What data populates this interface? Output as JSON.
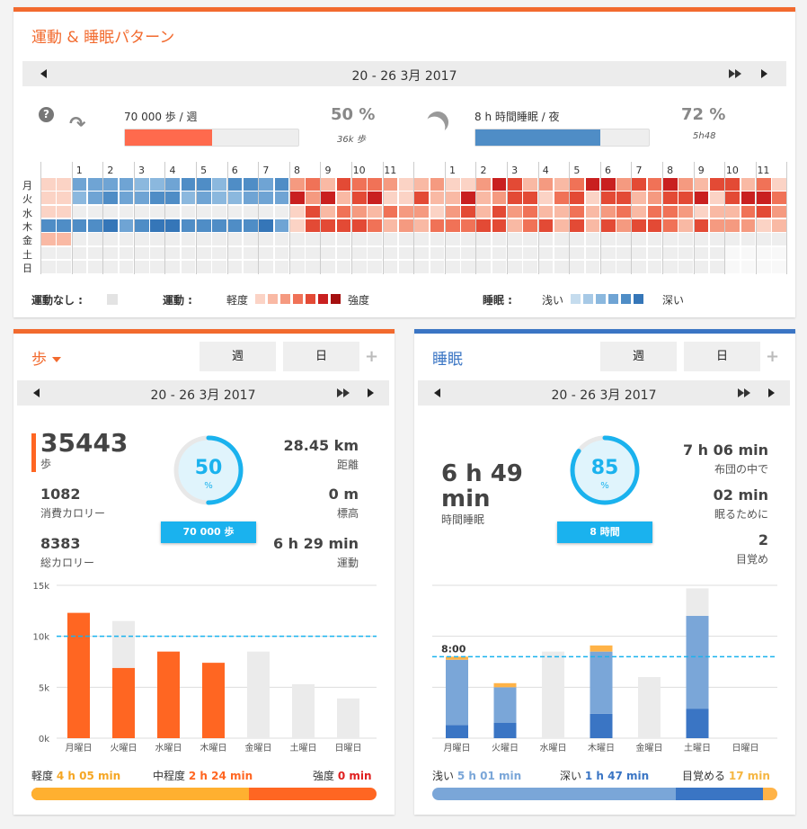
{
  "colors": {
    "orange": "#ff6622",
    "blue": "#3a75c4",
    "lightblue": "#7aa6d8",
    "amber": "#ffb347",
    "gray": "#ebebeb",
    "cyan": "#1ab2ee"
  },
  "header": {
    "title": "運動 & 睡眠パターン",
    "date_range": "20 - 26 3月 2017"
  },
  "activity_summary": {
    "steps_goal": "70 000 歩 / 週",
    "steps_pct": "50 %",
    "steps_sub": "36k 歩",
    "steps_fill": 0.5,
    "sleep_goal": "8 h 時間睡眠 / 夜",
    "sleep_pct": "72 %",
    "sleep_sub": "5h48",
    "sleep_fill": 0.72
  },
  "heatmap": {
    "days": [
      "月",
      "火",
      "水",
      "木",
      "金",
      "土",
      "日"
    ],
    "hours_left": [
      "1",
      "2",
      "3",
      "4",
      "5",
      "6",
      "7",
      "8",
      "9",
      "10",
      "11"
    ],
    "hours_right": [
      "1",
      "2",
      "3",
      "4",
      "5",
      "6",
      "7",
      "8",
      "9",
      "10",
      "11"
    ]
  },
  "legend": {
    "none_label": "運動なし :",
    "activity_label": "運動 :",
    "light": "軽度",
    "strong": "強度",
    "sleep_label": "睡眠 :",
    "shallow": "浅い",
    "deep": "深い",
    "activity_colors": [
      "#fbd3c5",
      "#f9b9a4",
      "#f59a80",
      "#f07257",
      "#e34a35",
      "#c92020",
      "#a51010"
    ],
    "sleep_colors": [
      "#c5dcee",
      "#a7c9e6",
      "#8bb8de",
      "#6fa4d4",
      "#4f8dc6",
      "#3576b8"
    ]
  },
  "steps_card": {
    "title": "歩",
    "tab_week": "週",
    "tab_day": "日",
    "date_range": "20 - 26 3月 2017",
    "steps": "35443",
    "steps_unit": "歩",
    "cal_burn": "1082",
    "cal_burn_label": "消費カロリー",
    "cal_total": "8383",
    "cal_total_label": "総カロリー",
    "ring_pct": "50",
    "ring_unit": "%",
    "ring_fill": 0.5,
    "badge": "70 000 歩",
    "dist": "28.45 km",
    "dist_label": "距離",
    "elev": "0 m",
    "elev_label": "標高",
    "active": "6 h 29 min",
    "active_label": "運動",
    "footer": {
      "light_label": "軽度",
      "light_val": "4 h 05 min",
      "mid_label": "中程度",
      "mid_val": "2 h 24 min",
      "strong_label": "強度",
      "strong_val": "0 min"
    }
  },
  "sleep_card": {
    "title": "睡眠",
    "tab_week": "週",
    "tab_day": "日",
    "date_range": "20 - 26 3月 2017",
    "sleep_h": "6 h 49",
    "sleep_min": "min",
    "sleep_label": "時間睡眠",
    "ring_pct": "85",
    "ring_unit": "%",
    "ring_fill": 0.85,
    "badge": "8 時間",
    "bed": "7 h 06 min",
    "bed_label": "布団の中で",
    "fall": "02 min",
    "fall_label": "眠るために",
    "wake": "2",
    "wake_label": "目覚め",
    "footer": {
      "light_label": "浅い",
      "light_val": "5 h 01 min",
      "deep_label": "深い",
      "deep_val": "1 h 47 min",
      "wake_label": "目覚める",
      "wake_val": "17 min"
    }
  },
  "chart_data": [
    {
      "type": "bar",
      "title": "",
      "categories": [
        "月曜日",
        "火曜日",
        "水曜日",
        "木曜日",
        "金曜日",
        "土曜日",
        "日曜日"
      ],
      "series": [
        {
          "values": [
            12300,
            6900,
            8500,
            7400,
            0,
            0,
            0
          ]
        },
        {
          "values": [
            0,
            4600,
            0,
            0,
            8500,
            5300,
            3900
          ]
        }
      ],
      "yticks": [
        "0k",
        "5k",
        "10k",
        "15k"
      ],
      "ylim": [
        0,
        15000
      ],
      "goal_line": 10000
    },
    {
      "type": "bar",
      "title": "",
      "categories": [
        "月曜日",
        "火曜日",
        "水曜日",
        "木曜日",
        "金曜日",
        "土曜日",
        "日曜日"
      ],
      "series": [
        {
          "name": "深い",
          "values": [
            1.3,
            1.5,
            0,
            2.4,
            0,
            2.9,
            0
          ]
        },
        {
          "name": "浅い",
          "values": [
            6.4,
            3.5,
            0,
            6.1,
            0,
            9.1,
            0
          ]
        },
        {
          "name": "目覚める",
          "values": [
            0.3,
            0.4,
            0,
            0.6,
            0,
            0,
            0
          ]
        },
        {
          "values": [
            0,
            0,
            8.5,
            0,
            6.0,
            2.7,
            0
          ]
        }
      ],
      "goal_label": "8:00",
      "goal_line": 8,
      "ylim": [
        0,
        15
      ]
    }
  ]
}
